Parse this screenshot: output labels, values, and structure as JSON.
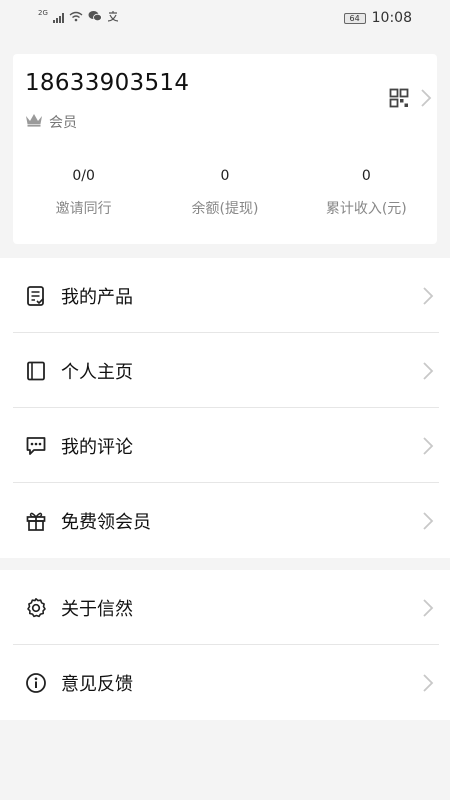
{
  "status_bar": {
    "network": "2G",
    "battery": "64",
    "time": "10:08"
  },
  "profile": {
    "phone": "18633903514",
    "member_label": "会员"
  },
  "stats": [
    {
      "value": "0/0",
      "label": "邀请同行"
    },
    {
      "value": "0",
      "label": "余额(提现)"
    },
    {
      "value": "0",
      "label": "累计收入(元)"
    }
  ],
  "menu_group_1": [
    {
      "label": "我的产品",
      "icon": "product-list-icon"
    },
    {
      "label": "个人主页",
      "icon": "homepage-book-icon"
    },
    {
      "label": "我的评论",
      "icon": "comment-icon"
    },
    {
      "label": "免费领会员",
      "icon": "gift-icon"
    }
  ],
  "menu_group_2": [
    {
      "label": "关于信然",
      "icon": "settings-gear-icon"
    },
    {
      "label": "意见反馈",
      "icon": "info-icon"
    }
  ]
}
